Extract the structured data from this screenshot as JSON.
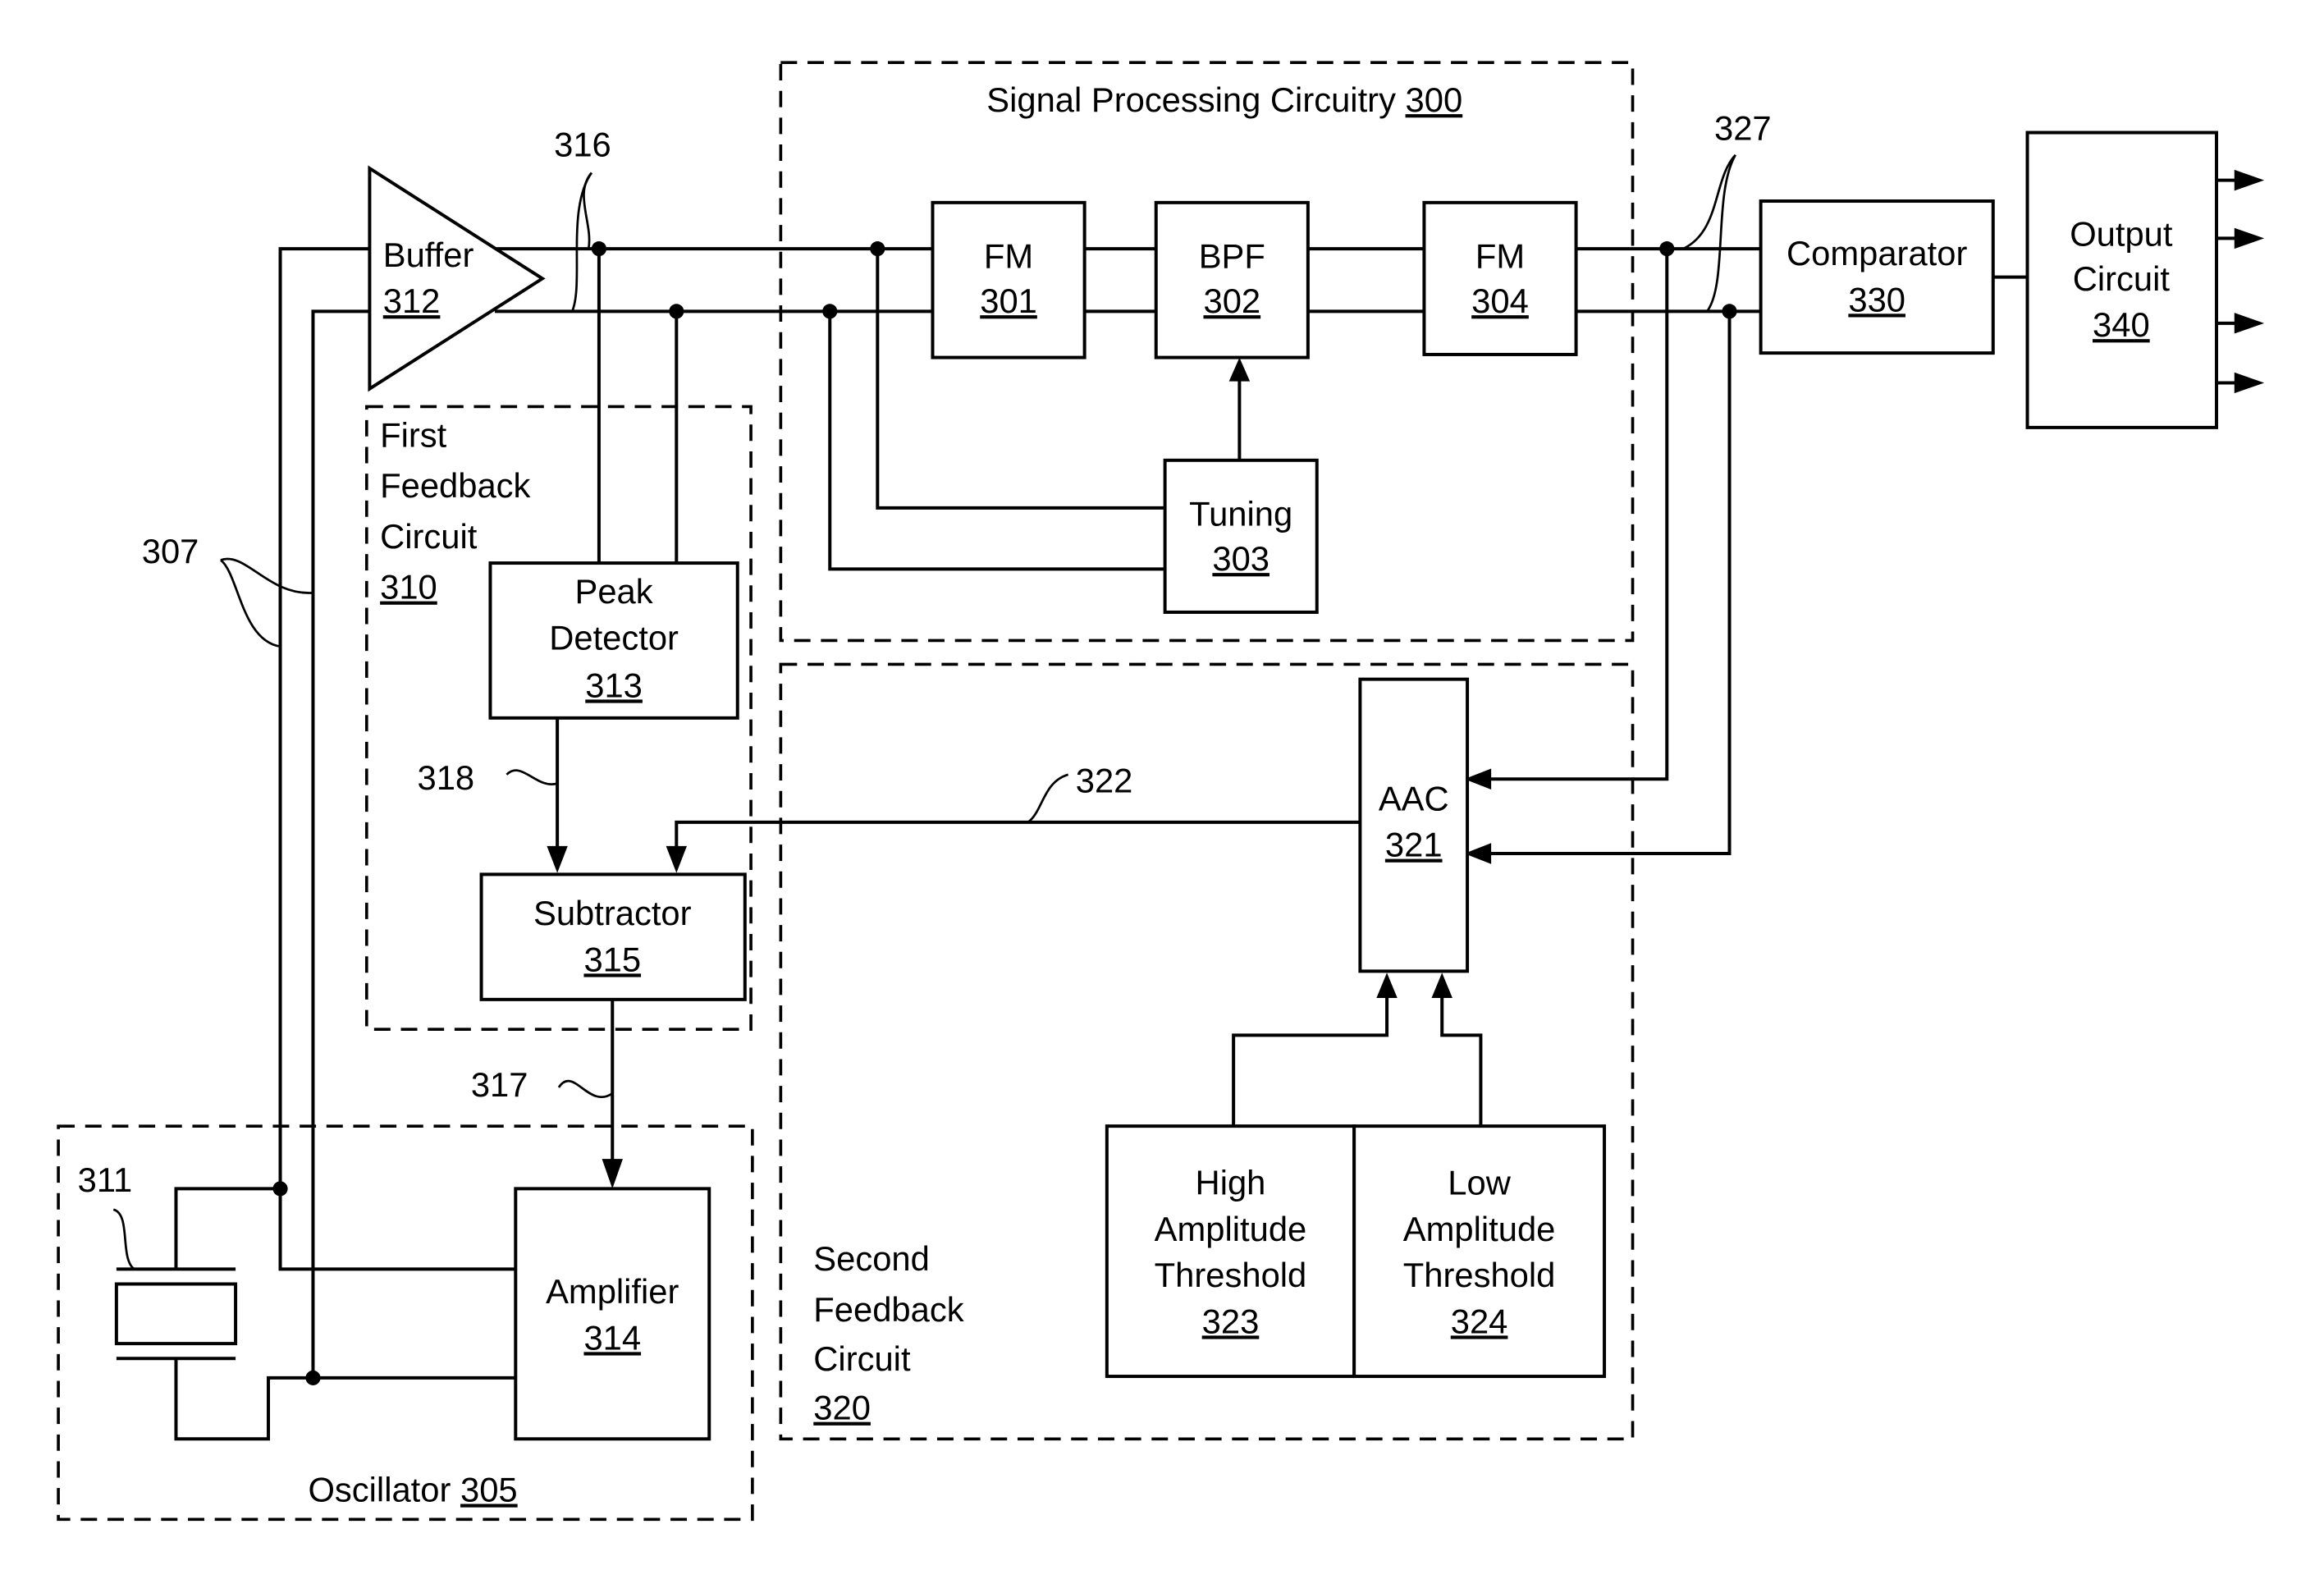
{
  "figure": {
    "groups": {
      "signal_processing": {
        "name": "Signal Processing Circuitry",
        "ref": "300"
      },
      "first_feedback": {
        "line1": "First",
        "line2": "Feedback",
        "line3": "Circuit",
        "ref": "310"
      },
      "second_feedback": {
        "line1": "Second",
        "line2": "Feedback",
        "line3": "Circuit",
        "ref": "320"
      },
      "oscillator": {
        "name": "Oscillator",
        "ref": "305"
      }
    },
    "blocks": {
      "buffer": {
        "name": "Buffer",
        "ref": "312"
      },
      "fm301": {
        "name": "FM",
        "ref": "301"
      },
      "bpf": {
        "name": "BPF",
        "ref": "302"
      },
      "fm304": {
        "name": "FM",
        "ref": "304"
      },
      "tuning": {
        "name": "Tuning",
        "ref": "303"
      },
      "comparator": {
        "name": "Comparator",
        "ref": "330"
      },
      "output": {
        "line1": "Output",
        "line2": "Circuit",
        "ref": "340"
      },
      "peak": {
        "line1": "Peak",
        "line2": "Detector",
        "ref": "313"
      },
      "subtractor": {
        "name": "Subtractor",
        "ref": "315"
      },
      "aac": {
        "name": "AAC",
        "ref": "321"
      },
      "high": {
        "line1": "High",
        "line2": "Amplitude",
        "line3": "Threshold",
        "ref": "323"
      },
      "low": {
        "line1": "Low",
        "line2": "Amplitude",
        "line3": "Threshold",
        "ref": "324"
      },
      "amplifier": {
        "name": "Amplifier",
        "ref": "314"
      }
    },
    "callouts": {
      "c316": "316",
      "c327": "327",
      "c307": "307",
      "c318": "318",
      "c322": "322",
      "c317": "317",
      "c311": "311"
    }
  }
}
